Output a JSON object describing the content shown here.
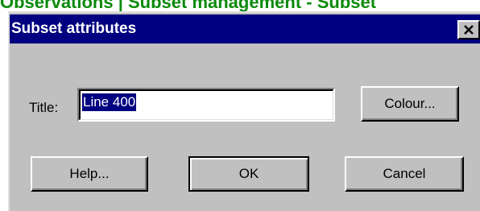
{
  "page": {
    "heading": "Observations | Subset management - Subset"
  },
  "dialog": {
    "title": "Subset attributes",
    "close_glyph": "×",
    "title_label": "Title:",
    "title_value": "Line 400",
    "buttons": {
      "colour": "Colour...",
      "help": "Help...",
      "ok": "OK",
      "cancel": "Cancel"
    }
  },
  "colors": {
    "heading_green": "#0b8a0b",
    "titlebar_navy": "#000080",
    "face_gray": "#c0c0c0",
    "selection_navy": "#000080"
  },
  "icons": {
    "close": "close-icon"
  }
}
